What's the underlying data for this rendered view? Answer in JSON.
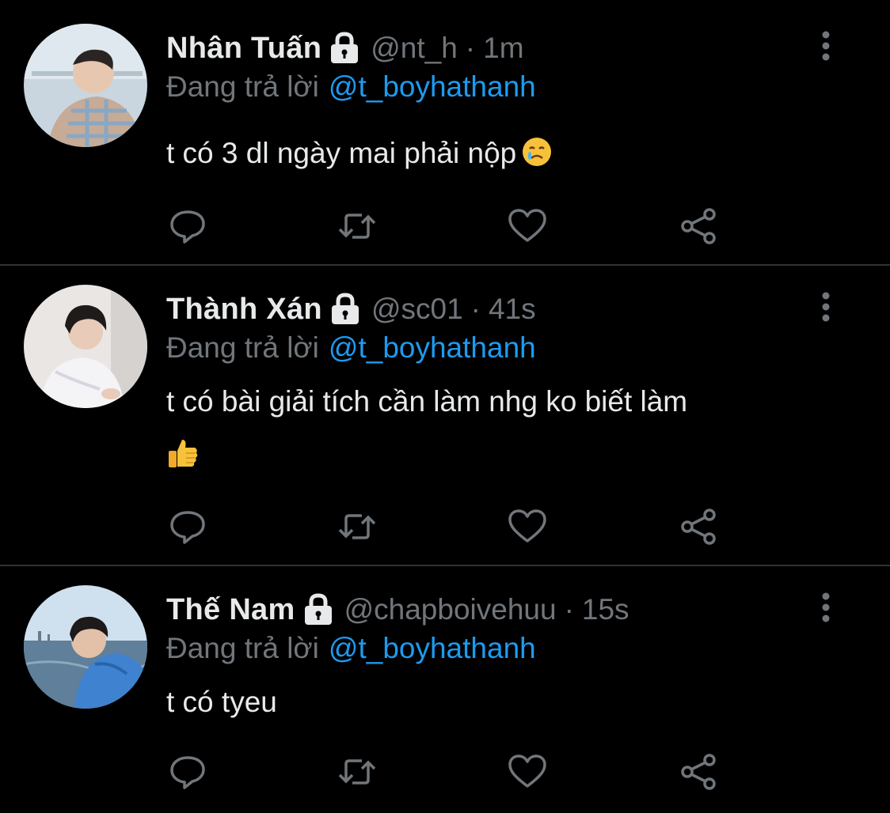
{
  "tweets": [
    {
      "display_name": "Nhân Tuấn",
      "handle": "@nt_h",
      "separator": "·",
      "time": "1m",
      "reply_prefix": "Đang trả lời",
      "reply_to": "@t_boyhathanh",
      "text_lines": [
        "t có 3 dl ngày mai phải nộp"
      ],
      "emoji": "face-holding-back-tears",
      "icons": {
        "lock": "lock-icon",
        "more": "more-vertical-icon"
      }
    },
    {
      "display_name": "Thành Xán",
      "handle": "@sc01",
      "separator": "·",
      "time": "41s",
      "reply_prefix": "Đang trả lời",
      "reply_to": "@t_boyhathanh",
      "text_lines": [
        "t có bài giải tích cần làm nhg ko biết làm"
      ],
      "emoji": "thumbs-up",
      "icons": {
        "lock": "lock-icon",
        "more": "more-vertical-icon"
      }
    },
    {
      "display_name": "Thế Nam",
      "handle": "@chapboivehuu",
      "separator": "·",
      "time": "15s",
      "reply_prefix": "Đang trả lời",
      "reply_to": "@t_boyhathanh",
      "text_lines": [
        "t có tyeu"
      ],
      "emoji": "",
      "icons": {
        "lock": "lock-icon",
        "more": "more-vertical-icon"
      }
    }
  ],
  "actions": [
    "reply-icon",
    "retweet-icon",
    "like-icon",
    "share-icon"
  ],
  "colors": {
    "background": "#000000",
    "text": "#e7e9ea",
    "muted": "#71767b",
    "accent": "#1d9bf0",
    "divider": "#2f3336"
  }
}
